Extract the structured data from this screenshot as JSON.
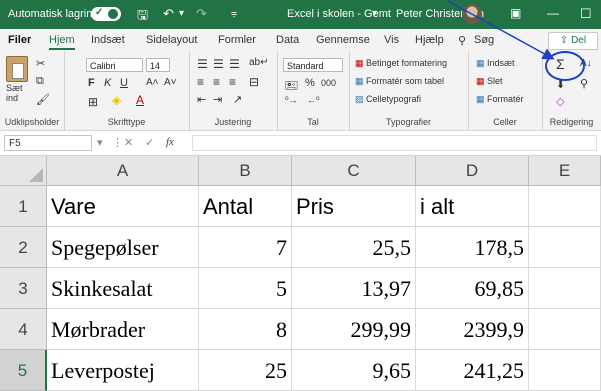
{
  "title_bar": {
    "autosave_label": "Automatisk lagring",
    "autosave_state": "on",
    "title": "Excel i skolen - Gemt",
    "user": "Peter Christensen"
  },
  "tabs": [
    "Filer",
    "Hjem",
    "Indsæt",
    "Sidelayout",
    "Formler",
    "Data",
    "Gennemse",
    "Vis",
    "Hjælp"
  ],
  "active_tab": "Hjem",
  "search_label": "Søg",
  "share_label": "Del",
  "ribbon": {
    "clipboard": {
      "paste_label": "Sæt ind",
      "group_label": "Udklipsholder"
    },
    "font": {
      "font_name": "Calibri",
      "font_size": "14",
      "bold": "F",
      "italic": "K",
      "underline": "U",
      "grow": "A˄",
      "shrink": "A˅",
      "group_label": "Skrifttype"
    },
    "alignment": {
      "group_label": "Justering"
    },
    "number": {
      "format": "Standard",
      "percent": "%",
      "thousands": "000",
      "group_label": "Tal"
    },
    "styles": {
      "conditional": "Betinget formatering",
      "as_table": "Formatér som tabel",
      "cell_styles": "Celletypografi",
      "group_label": "Typografier"
    },
    "cells": {
      "insert": "Indsæt",
      "delete": "Slet",
      "format": "Formatér",
      "group_label": "Celler"
    },
    "editing": {
      "autosum": "Σ",
      "group_label": "Redigering"
    }
  },
  "formula_bar": {
    "name_box": "F5",
    "fx": "fx",
    "formula": ""
  },
  "columns": [
    "A",
    "B",
    "C",
    "D",
    "E"
  ],
  "rows": [
    {
      "num": "1",
      "A": "Vare",
      "B": "Antal",
      "C": "Pris",
      "D": "i alt"
    },
    {
      "num": "2",
      "A": "Spegepølser",
      "B": "7",
      "C": "25,5",
      "D": "178,5"
    },
    {
      "num": "3",
      "A": "Skinkesalat",
      "B": "5",
      "C": "13,97",
      "D": "69,85"
    },
    {
      "num": "4",
      "A": "Mørbrader",
      "B": "8",
      "C": "299,99",
      "D": "2399,9"
    },
    {
      "num": "5",
      "A": "Leverpostej",
      "B": "25",
      "C": "9,65",
      "D": "241,25"
    }
  ],
  "colors": {
    "accent": "#217346",
    "annotation": "#1f3ec9"
  }
}
